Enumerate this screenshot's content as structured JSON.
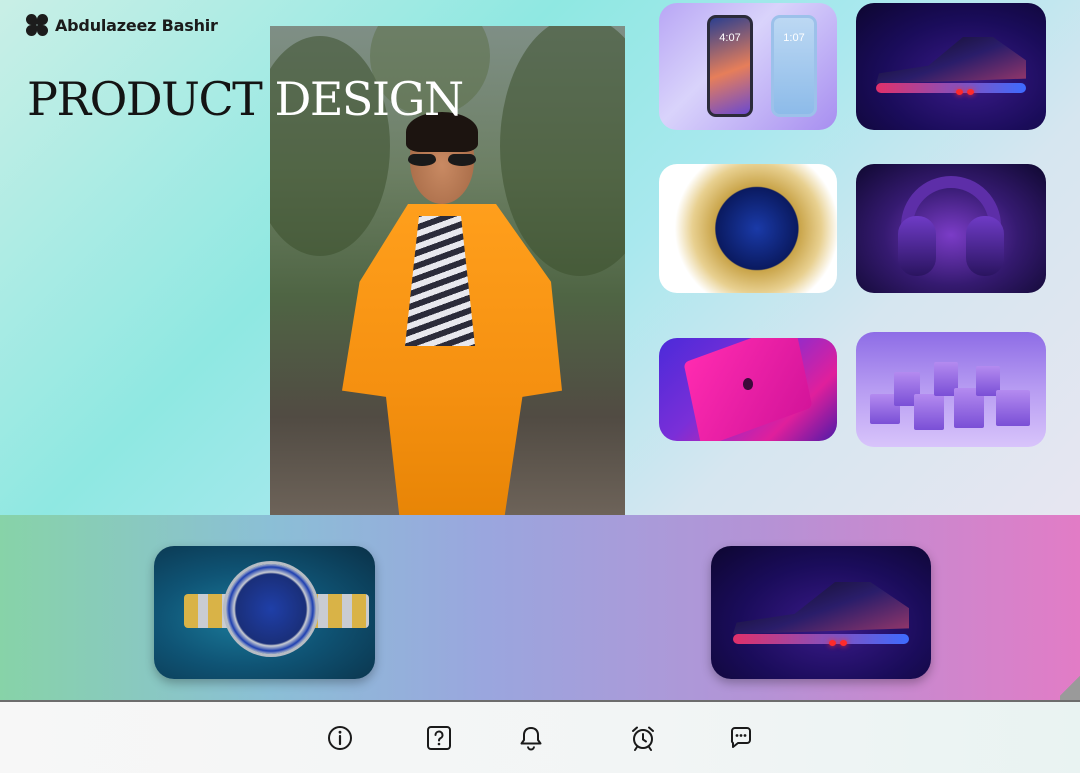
{
  "brand": {
    "name": "Abdulazeez Bashir"
  },
  "hero": {
    "headline_dark": "PRODUCT ",
    "headline_light": "DESIGN"
  },
  "thumbnails": {
    "phones": {
      "time_a": "4:07",
      "time_b": "1:07"
    }
  },
  "dock": {
    "items": [
      "info-icon",
      "help-icon",
      "bell-icon",
      "alarm-clock-icon",
      "chat-icon"
    ]
  },
  "colors": {
    "accent_orange": "#f59010",
    "dock_icon": "#1a1a1a"
  }
}
